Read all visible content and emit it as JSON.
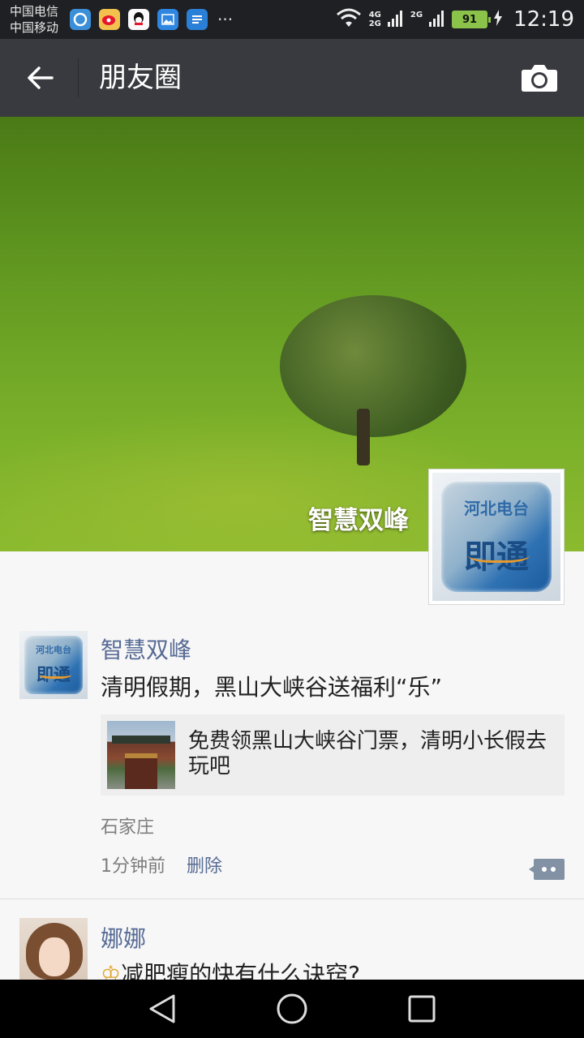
{
  "status_bar": {
    "carrier_1": "中国电信",
    "carrier_2": "中国移动",
    "more": "···",
    "net_4g": "4G",
    "net_2g_a": "2G",
    "net_2g_b": "2G",
    "battery": "91",
    "time": "12:19",
    "icons": [
      "browser-icon",
      "weibo-icon",
      "qq-icon",
      "gallery-icon",
      "notes-icon"
    ],
    "accent_battery": "#8bc34a"
  },
  "nav": {
    "title": "朋友圈",
    "back_icon": "arrow-left-icon",
    "camera_icon": "camera-icon",
    "bg": "#393a3f"
  },
  "cover": {
    "name": "智慧双峰",
    "logo_top": "河北电台",
    "logo_main": "即通"
  },
  "posts": [
    {
      "name": "智慧双峰",
      "text": "清明假期，黑山大峡谷送福利“乐”",
      "link_title": "免费领黑山大峡谷门票，清明小长假去玩吧",
      "location": "石家庄",
      "time": "1分钟前",
      "delete": "删除",
      "avatar_top": "河北电台",
      "avatar_main": "即通"
    },
    {
      "name": "娜娜",
      "text": "减肥瘦的快有什么诀窍?"
    }
  ],
  "name_color": "#576b95"
}
